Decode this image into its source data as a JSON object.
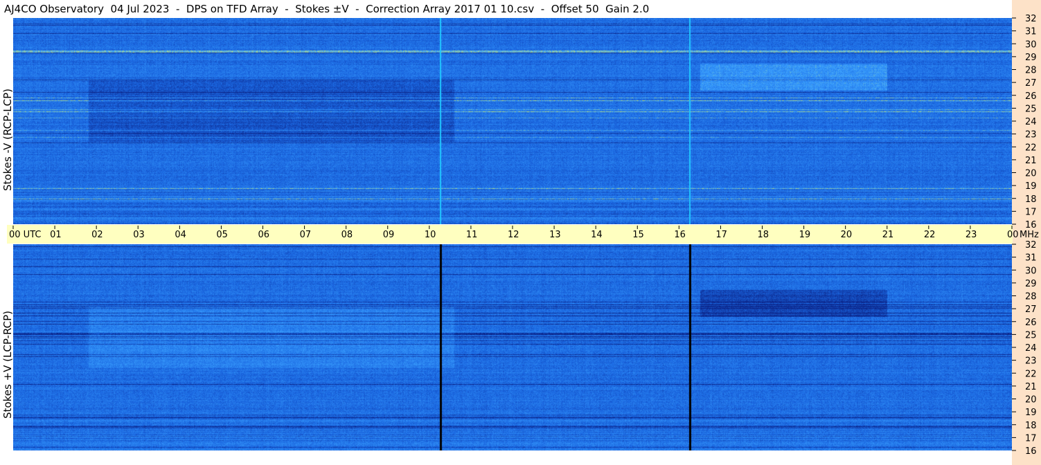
{
  "title": "AJ4CO Observatory  04 Jul 2023  -  DPS on TFD Array  -  Stokes ±V  -  Correction Array 2017 01 10.csv  -  Offset 50  Gain 2.0",
  "time_axis": {
    "start_label": "00  UTC",
    "end_label": "00",
    "unit_label": "MHz"
  },
  "chart_data": [
    {
      "type": "heatmap",
      "ylabel": "Stokes -V (RCP-LCP)",
      "x_labels": [
        "01",
        "02",
        "03",
        "04",
        "05",
        "06",
        "07",
        "08",
        "09",
        "10",
        "11",
        "12",
        "13",
        "14",
        "15",
        "16",
        "17",
        "18",
        "19",
        "20",
        "21",
        "22",
        "23"
      ],
      "x_range_hours": [
        0,
        24
      ],
      "y_ticks": [
        16,
        17,
        18,
        19,
        20,
        21,
        22,
        23,
        24,
        25,
        26,
        27,
        28,
        29,
        30,
        31,
        32
      ],
      "y_range_mhz": [
        16,
        32
      ],
      "grid": false,
      "markers_utc_hours": [
        10.25,
        16.25
      ],
      "colors": {
        "low": "#0a1e80",
        "mid": "#1a66e0",
        "high": "#3aa0ff",
        "peak": "#d8f060",
        "marker": "#20c8ff"
      }
    },
    {
      "type": "heatmap",
      "ylabel": "Stokes +V (LCP-RCP)",
      "x_labels": [
        "01",
        "02",
        "03",
        "04",
        "05",
        "06",
        "07",
        "08",
        "09",
        "10",
        "11",
        "12",
        "13",
        "14",
        "15",
        "16",
        "17",
        "18",
        "19",
        "20",
        "21",
        "22",
        "23"
      ],
      "x_range_hours": [
        0,
        24
      ],
      "y_ticks": [
        16,
        17,
        18,
        19,
        20,
        21,
        22,
        23,
        24,
        25,
        26,
        27,
        28,
        29,
        30,
        31,
        32
      ],
      "y_range_mhz": [
        16,
        32
      ],
      "grid": false,
      "markers_utc_hours": [
        10.25,
        16.25
      ],
      "colors": {
        "low": "#0a1e80",
        "mid": "#1a66e0",
        "high": "#3aa0ff",
        "peak": "#d8f060",
        "marker": "#000000"
      }
    }
  ]
}
